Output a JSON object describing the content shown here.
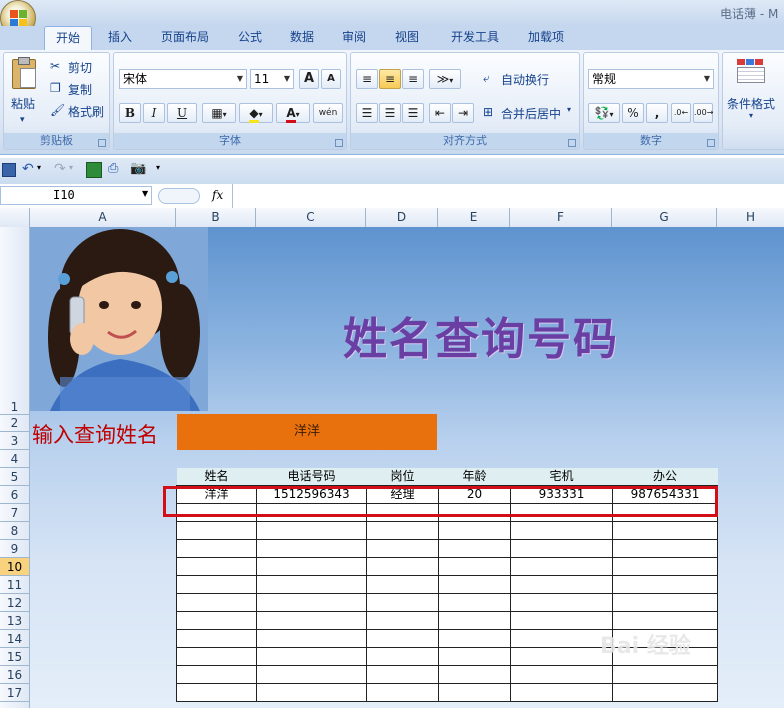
{
  "window": {
    "title": "电话薄 - M"
  },
  "tabs": [
    "开始",
    "插入",
    "页面布局",
    "公式",
    "数据",
    "审阅",
    "视图",
    "开发工具",
    "加载项"
  ],
  "ribbon": {
    "clipboard": {
      "label": "剪贴板",
      "paste": "粘贴",
      "cut": "剪切",
      "copy": "复制",
      "format_painter": "格式刷"
    },
    "font": {
      "label": "字体",
      "name": "宋体",
      "size": "11",
      "bold": "B",
      "italic": "I",
      "underline": "U",
      "grow": "A",
      "shrink": "A",
      "phonetic": "wén"
    },
    "alignment": {
      "label": "对齐方式",
      "wrap": "自动换行",
      "merge": "合并后居中"
    },
    "number": {
      "label": "数字",
      "format": "常规",
      "percent": "%",
      "comma": ","
    },
    "styles": {
      "conditional": "条件格式"
    }
  },
  "formula_bar": {
    "name_box": "I10",
    "fx": "fx",
    "content": ""
  },
  "columns": [
    "A",
    "B",
    "C",
    "D",
    "E",
    "F",
    "G",
    "H"
  ],
  "rows": [
    "1",
    "2",
    "3",
    "4",
    "5",
    "6",
    "7",
    "8",
    "9",
    "10",
    "11",
    "12",
    "13",
    "14",
    "15",
    "16",
    "17"
  ],
  "selected_row": "10",
  "sheet": {
    "banner_title": "姓名查询号码",
    "prompt_label": "输入查询姓名",
    "search_value": "洋洋",
    "table": {
      "headers": [
        "姓名",
        "电话号码",
        "岗位",
        "年龄",
        "宅机",
        "办公"
      ],
      "rows": [
        [
          "洋洋",
          "1512596343",
          "经理",
          "20",
          "933331",
          "987654331"
        ],
        [
          "",
          "",
          "",
          "",
          "",
          ""
        ],
        [
          "",
          "",
          "",
          "",
          "",
          ""
        ],
        [
          "",
          "",
          "",
          "",
          "",
          ""
        ],
        [
          "",
          "",
          "",
          "",
          "",
          ""
        ],
        [
          "",
          "",
          "",
          "",
          "",
          ""
        ],
        [
          "",
          "",
          "",
          "",
          "",
          ""
        ],
        [
          "",
          "",
          "",
          "",
          "",
          ""
        ],
        [
          "",
          "",
          "",
          "",
          "",
          ""
        ],
        [
          "",
          "",
          "",
          "",
          "",
          ""
        ],
        [
          "",
          "",
          "",
          "",
          "",
          ""
        ],
        [
          "",
          "",
          "",
          "",
          "",
          ""
        ]
      ]
    }
  },
  "watermark": "Bai 经验",
  "colors": {
    "accent_orange": "#e8710e",
    "title_purple": "#6a3fa3",
    "highlight_red": "#d20f18",
    "prompt_red": "#c00000"
  }
}
